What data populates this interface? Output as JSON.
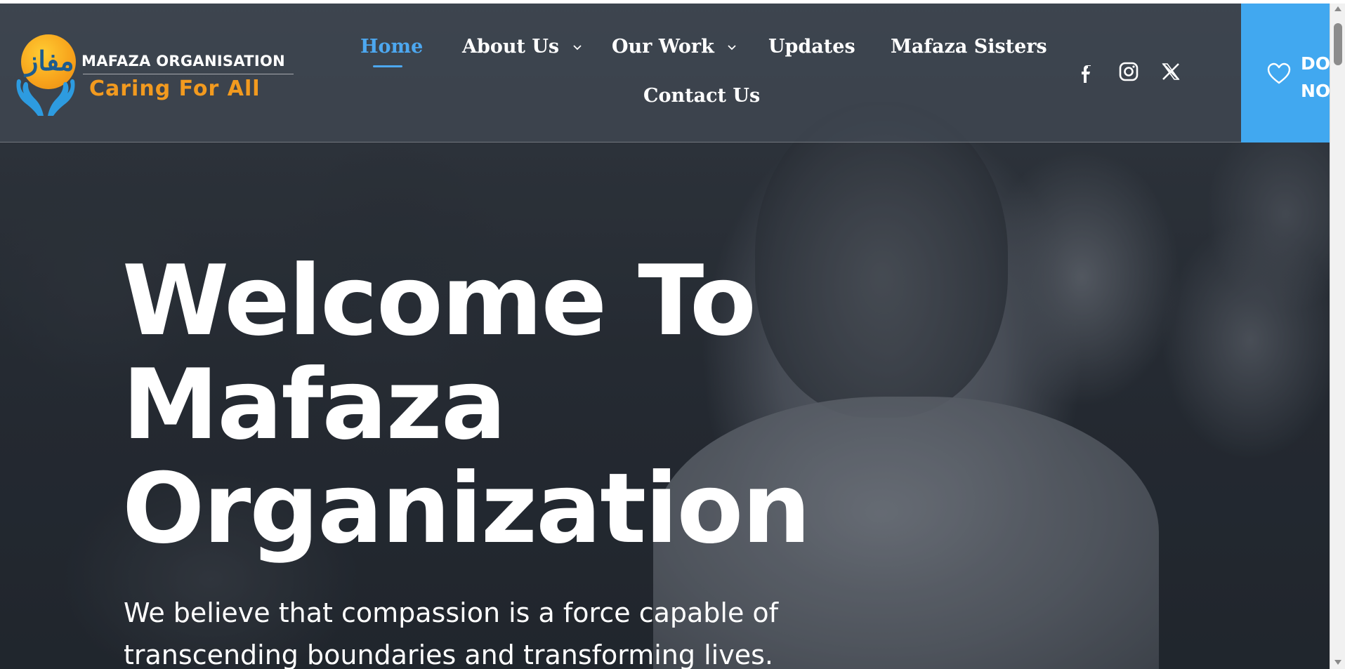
{
  "header": {
    "logo": {
      "arabic_text": "مفاز",
      "title": "MAFAZA ORGANISATION",
      "tagline": "Caring For All"
    },
    "nav": [
      {
        "label": "Home",
        "active": true
      },
      {
        "label": "About Us",
        "has_dropdown": true
      },
      {
        "label": "Our Work",
        "has_dropdown": true
      },
      {
        "label": "Updates"
      },
      {
        "label": "Mafaza Sisters"
      },
      {
        "label": "Contact Us"
      }
    ],
    "socials": [
      "facebook-icon",
      "instagram-icon",
      "x-icon"
    ],
    "donate": {
      "line1": "DONATE",
      "line2": "NOW",
      "icon": "heart-icon"
    }
  },
  "hero": {
    "title_lines": [
      "Welcome To",
      "Mafaza",
      "Organization"
    ],
    "subtitle_lines": [
      "We believe that compassion is a force capable of",
      "transcending boundaries and transforming lives."
    ]
  },
  "colors": {
    "accent": "#41a8f0",
    "active_nav": "#4da8f0",
    "logo_orange": "#f29a1f",
    "logo_blue": "#2d9be0"
  }
}
